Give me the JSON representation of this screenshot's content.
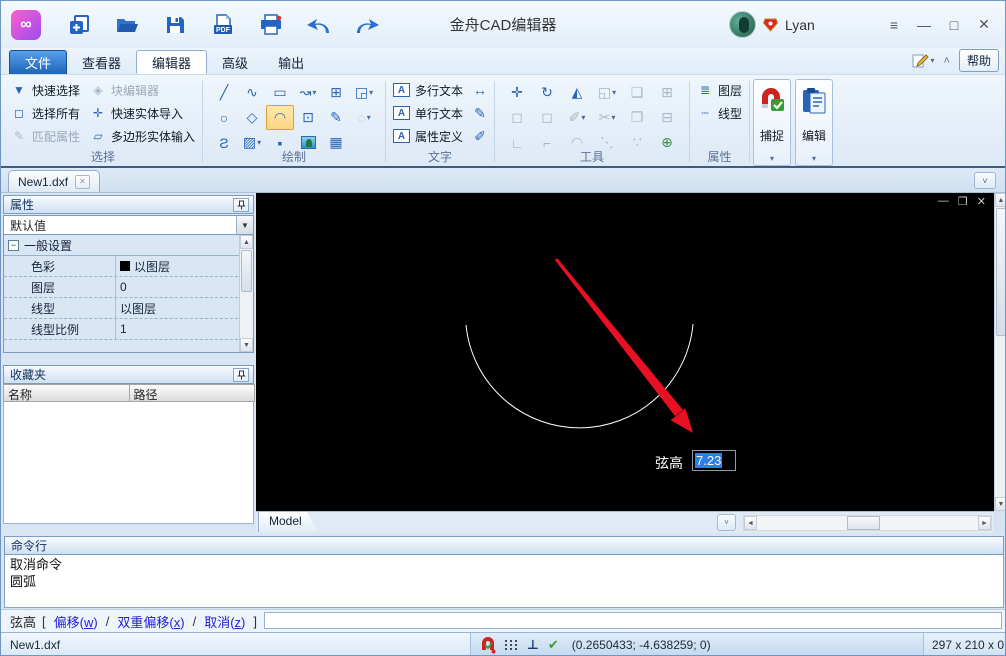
{
  "titlebar": {
    "title": "金舟CAD编辑器",
    "username": "Lyan"
  },
  "menubar": {
    "tabs": [
      {
        "label": "文件"
      },
      {
        "label": "查看器"
      },
      {
        "label": "编辑器"
      },
      {
        "label": "高级"
      },
      {
        "label": "输出"
      }
    ],
    "help": "帮助"
  },
  "ribbon": {
    "select": {
      "label": "选择",
      "items": [
        {
          "label": "快速选择"
        },
        {
          "label": "选择所有"
        },
        {
          "label": "匹配属性"
        },
        {
          "label": "块编辑器"
        },
        {
          "label": "快速实体导入"
        },
        {
          "label": "多边形实体输入"
        }
      ]
    },
    "draw": {
      "label": "绘制"
    },
    "text": {
      "label": "文字",
      "items": [
        {
          "label": "多行文本"
        },
        {
          "label": "单行文本"
        },
        {
          "label": "属性定义"
        }
      ]
    },
    "tools": {
      "label": "工具"
    },
    "properties": {
      "label": "属性",
      "items": [
        {
          "label": "图层"
        },
        {
          "label": "线型"
        }
      ]
    },
    "snap": {
      "label": "捕捉"
    },
    "edit": {
      "label": "编辑"
    }
  },
  "doctab": {
    "label": "New1.dxf"
  },
  "props_panel": {
    "title": "属性",
    "preset": "默认值",
    "group_header": "一般设置",
    "rows": [
      {
        "name": "色彩",
        "value": "以图层",
        "swatch": "#000000"
      },
      {
        "name": "图层",
        "value": "0"
      },
      {
        "name": "线型",
        "value": "以图层"
      },
      {
        "name": "线型比例",
        "value": "1"
      }
    ]
  },
  "fav_panel": {
    "title": "收藏夹",
    "columns": [
      {
        "label": "名称"
      },
      {
        "label": "路径"
      }
    ]
  },
  "canvas": {
    "chord_label": "弦高",
    "chord_value": "7.23",
    "model_tab": "Model"
  },
  "cmd_panel": {
    "title": "命令行",
    "lines": [
      {
        "text": "取消命令"
      },
      {
        "text": "圆弧"
      }
    ]
  },
  "prompt": {
    "command": "弦高",
    "bracket_open": "[",
    "bracket_close": "]",
    "options": [
      {
        "label": "偏移",
        "key": "w"
      },
      {
        "label": "双重偏移",
        "key": "x"
      },
      {
        "label": "取消",
        "key": "z"
      }
    ]
  },
  "statusbar": {
    "filename": "New1.dxf",
    "coords": "(0.2650433; -4.638259; 0)",
    "dims": "297 x 210 x 0"
  },
  "glyphs": {
    "logo": "∞",
    "menu_burger": "≡",
    "win_min": "—",
    "win_max": "□",
    "win_close": "✕",
    "collapse": "˄",
    "panel_chevron": "˅",
    "doc_close": "✕",
    "dropdown": "▾",
    "canvas_min": "—",
    "canvas_restore": "❐",
    "canvas_close": "✕",
    "funnel": "▼",
    "select_all": "◻",
    "match": "✎",
    "block_editor": "◈",
    "quick_entity": "✛",
    "polygon_entity": "▱",
    "d11": "╱",
    "d12": "∿",
    "d13": "▭",
    "d14": "↝",
    "d15": "⊞",
    "d16": "◲",
    "d21": "○",
    "d22": "◇",
    "d23": "◠",
    "d24": "⊡",
    "d25": "✎",
    "d26": "◌",
    "d31": "Ƨ",
    "d32": "▨",
    "d33": "▪",
    "d35": "▦",
    "text_a": "A",
    "dim": "↔",
    "tstyle": "✎",
    "tedit": "✐",
    "t11": "✛",
    "t12": "↻",
    "t13": "◭",
    "t14": "◱",
    "t15": "❏",
    "t16": "⊞",
    "t21": "◻",
    "t22": "◻",
    "t23": "✐",
    "t24": "✂",
    "t25": "❐",
    "t26": "⊟",
    "t31": "∟",
    "t32": "⌐",
    "t33": "◠",
    "t34": "⋱",
    "t35": "∵",
    "t36": "⊕",
    "layers": "≣",
    "linetype": "┄",
    "expand_minus": "−",
    "scroll_up": "▲",
    "scroll_down": "▼",
    "scroll_left": "◄",
    "scroll_right": "►",
    "perp": "⊥",
    "check": "✔"
  },
  "colors": {
    "accent": "#2a64b8",
    "link": "#2121d6",
    "selection": "#2a7fe8",
    "canvas_bg": "#000000",
    "arrow": "#e81123",
    "arc": "#ffffff",
    "active_tool_bg": "#fcd680",
    "logo_gradient_start": "#ff5ecb",
    "logo_gradient_end": "#9a4cf0"
  }
}
